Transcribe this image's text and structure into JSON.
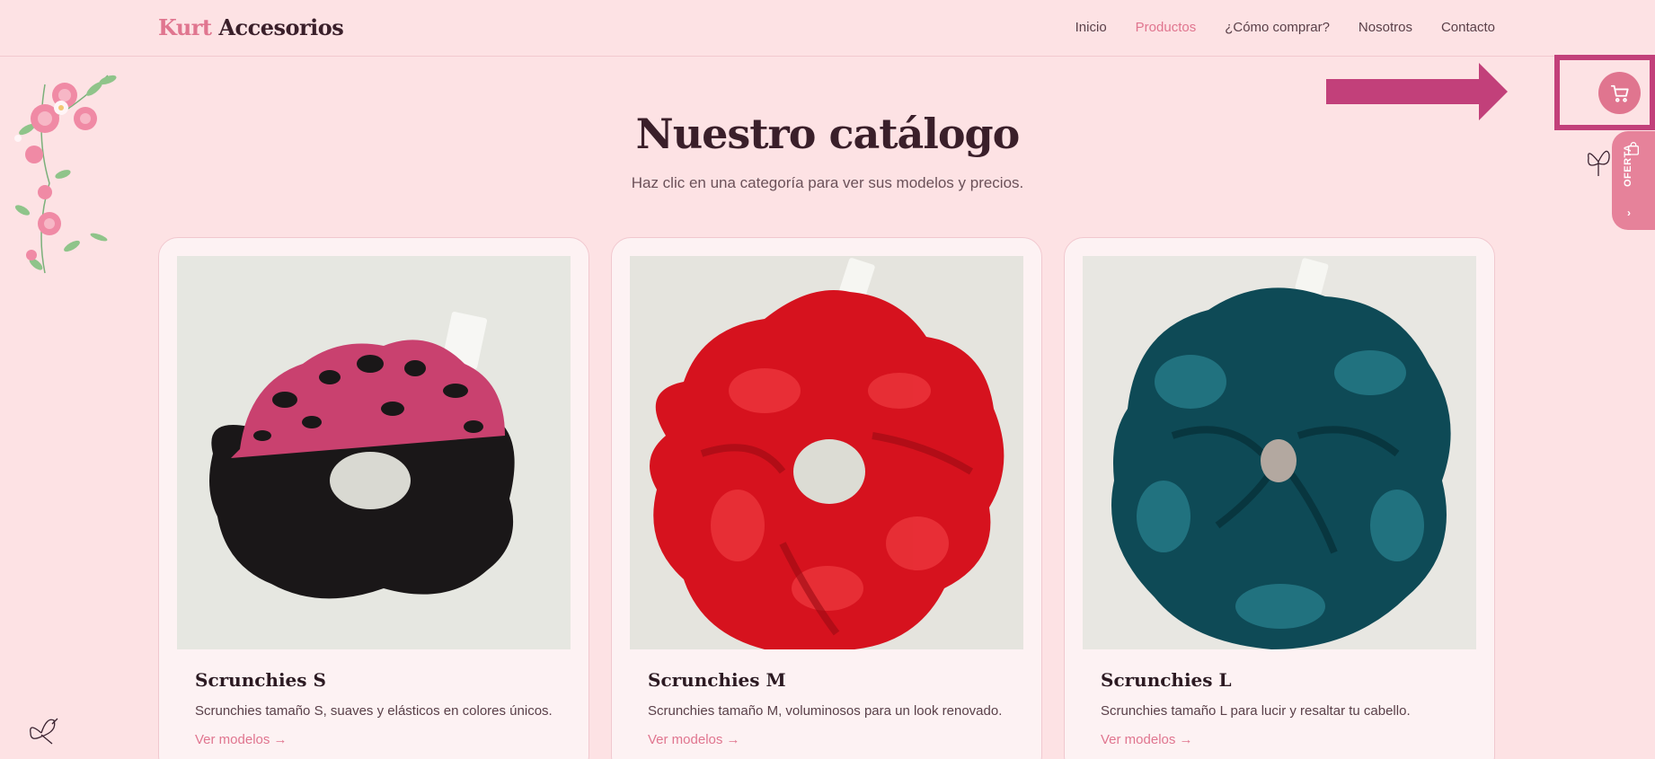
{
  "header": {
    "logo_brand": "Kurt",
    "logo_rest": "Accesorios",
    "nav": [
      {
        "label": "Inicio",
        "active": false
      },
      {
        "label": "Productos",
        "active": true
      },
      {
        "label": "¿Cómo comprar?",
        "active": false
      },
      {
        "label": "Nosotros",
        "active": false
      },
      {
        "label": "Contacto",
        "active": false
      }
    ]
  },
  "main": {
    "title": "Nuestro catálogo",
    "subtitle": "Haz clic en una categoría para ver sus modelos y precios."
  },
  "cards": [
    {
      "name": "Scrunchies S",
      "description": "Scrunchies tamaño S, suaves y elásticos en colores únicos.",
      "link": "Ver modelos →",
      "image": "black-and-pink-leopard-scrunchie"
    },
    {
      "name": "Scrunchies M",
      "description": "Scrunchies tamaño M, voluminosos para un look renovado.",
      "link": "Ver modelos →",
      "image": "red-velvet-scrunchie"
    },
    {
      "name": "Scrunchies L",
      "description": "Scrunchies tamaño L para lucir y resaltar tu cabello.",
      "link": "Ver modelos →",
      "image": "teal-velvet-scrunchie"
    }
  ],
  "floating": {
    "cart_icon": "cart-icon",
    "offer_label": "OFERTA",
    "offer_icon": "shopping-bag-icon"
  },
  "colors": {
    "background": "#fde2e4",
    "accent": "#e0758f",
    "annotation": "#c2407a",
    "title": "#3a1f2a"
  }
}
